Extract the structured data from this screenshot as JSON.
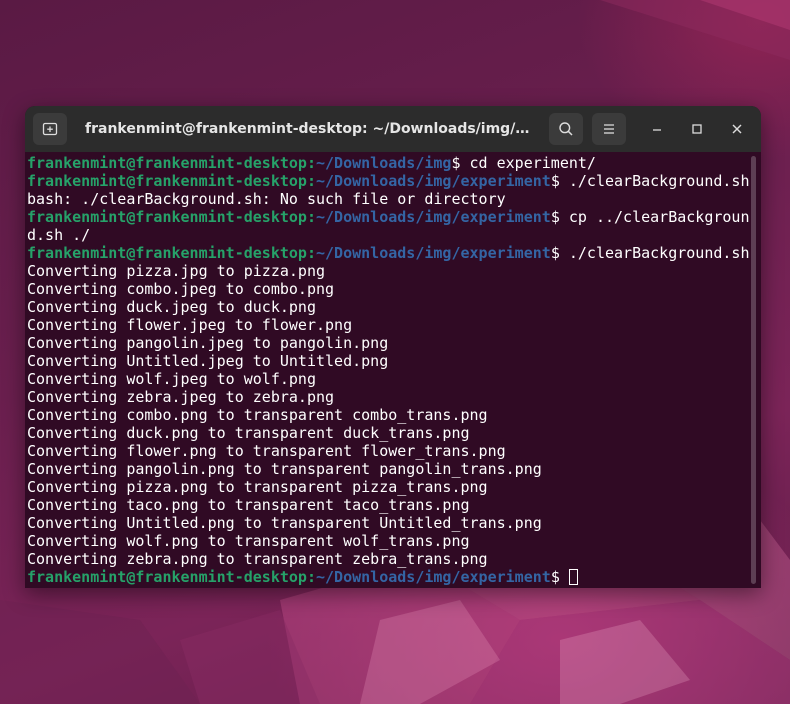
{
  "window": {
    "title": "frankenmint@frankenmint-desktop: ~/Downloads/img/expe..."
  },
  "titlebar_icons": {
    "new_tab": "new-tab-icon",
    "search": "search-icon",
    "menu": "hamburger-menu-icon",
    "minimize": "minimize-icon",
    "maximize": "maximize-icon",
    "close": "close-icon"
  },
  "colors": {
    "terminal_bg": "#300a24",
    "user_host": "#26a269",
    "path": "#3465a4",
    "text": "#ffffff",
    "titlebar": "#2c2c2c"
  },
  "terminal": {
    "lines": [
      {
        "user": "frankenmint@frankenmint-desktop",
        "sep": ":",
        "path": "~/Downloads/img",
        "cmd": "$ cd experiment/"
      },
      {
        "user": "frankenmint@frankenmint-desktop",
        "sep": ":",
        "path": "~/Downloads/img/experiment",
        "cmd": "$ ./clearBackground.sh"
      },
      {
        "text": "bash: ./clearBackground.sh: No such file or directory"
      },
      {
        "user": "frankenmint@frankenmint-desktop",
        "sep": ":",
        "path": "~/Downloads/img/experiment",
        "cmd": "$ cp ../clearBackgroun"
      },
      {
        "text": "d.sh ./"
      },
      {
        "user": "frankenmint@frankenmint-desktop",
        "sep": ":",
        "path": "~/Downloads/img/experiment",
        "cmd": "$ ./clearBackground.sh"
      },
      {
        "text": "Converting pizza.jpg to pizza.png"
      },
      {
        "text": "Converting combo.jpeg to combo.png"
      },
      {
        "text": "Converting duck.jpeg to duck.png"
      },
      {
        "text": "Converting flower.jpeg to flower.png"
      },
      {
        "text": "Converting pangolin.jpeg to pangolin.png"
      },
      {
        "text": "Converting Untitled.jpeg to Untitled.png"
      },
      {
        "text": "Converting wolf.jpeg to wolf.png"
      },
      {
        "text": "Converting zebra.jpeg to zebra.png"
      },
      {
        "text": "Converting combo.png to transparent combo_trans.png"
      },
      {
        "text": "Converting duck.png to transparent duck_trans.png"
      },
      {
        "text": "Converting flower.png to transparent flower_trans.png"
      },
      {
        "text": "Converting pangolin.png to transparent pangolin_trans.png"
      },
      {
        "text": "Converting pizza.png to transparent pizza_trans.png"
      },
      {
        "text": "Converting taco.png to transparent taco_trans.png"
      },
      {
        "text": "Converting Untitled.png to transparent Untitled_trans.png"
      },
      {
        "text": "Converting wolf.png to transparent wolf_trans.png"
      },
      {
        "text": "Converting zebra.png to transparent zebra_trans.png"
      }
    ],
    "prompt": {
      "user": "frankenmint@frankenmint-desktop",
      "sep": ":",
      "path": "~/Downloads/img/experiment",
      "cmd": "$ "
    }
  }
}
